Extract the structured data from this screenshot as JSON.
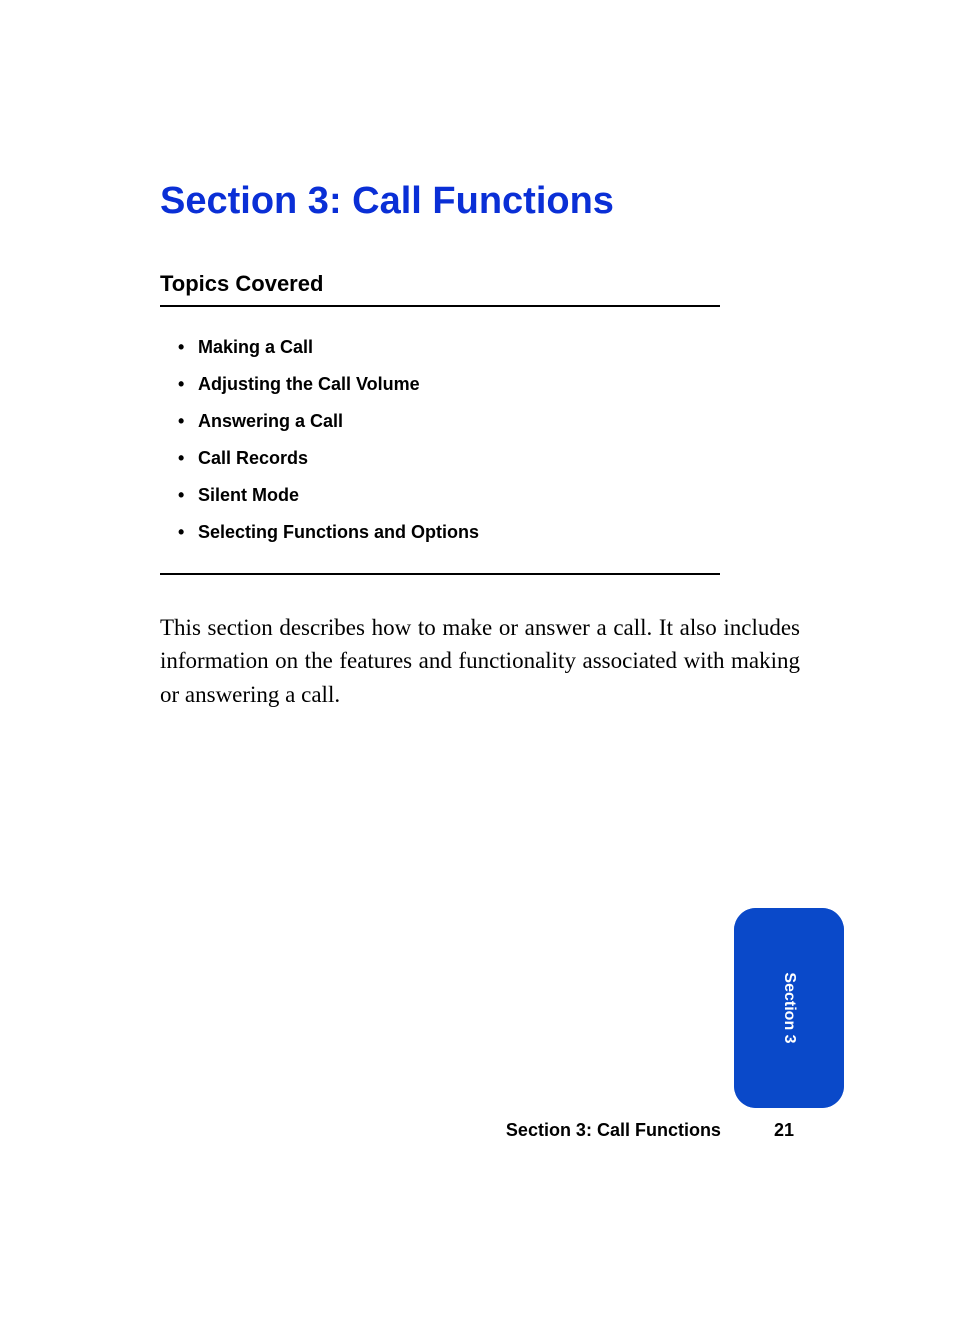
{
  "title": "Section 3: Call Functions",
  "subhead": "Topics Covered",
  "topics": [
    "Making a Call",
    "Adjusting the Call Volume",
    "Answering a Call",
    "Call Records",
    "Silent Mode",
    "Selecting Functions and Options"
  ],
  "body": "This section describes how to make or answer a call. It also includes information on the features and functionality associated with making or answering a call.",
  "tab_label": "Section 3",
  "footer_title": "Section 3: Call Functions",
  "page_number": "21"
}
